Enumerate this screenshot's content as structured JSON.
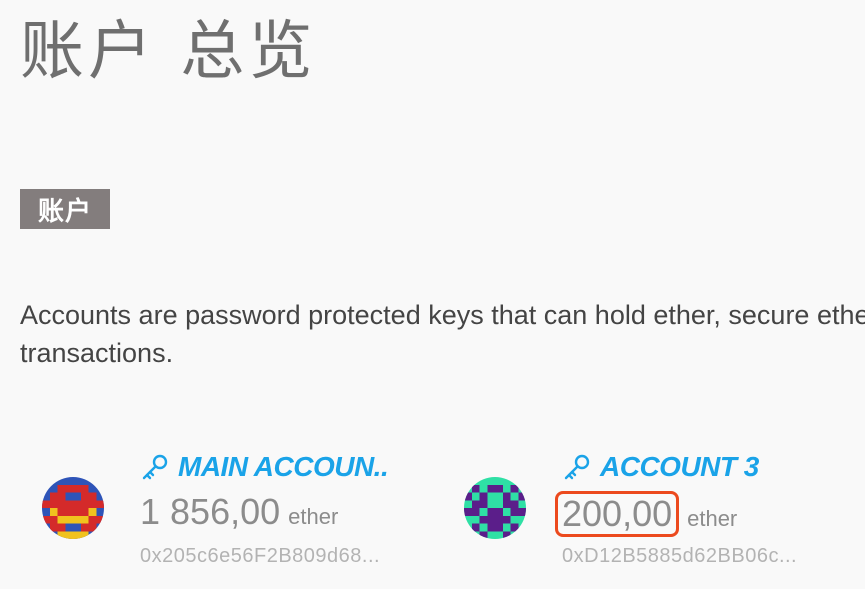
{
  "page": {
    "title": "账户 总览"
  },
  "section": {
    "badge": "账户",
    "description_line1": "Accounts are password protected keys that can hold ether, secure ether",
    "description_line2": "transactions."
  },
  "accounts": [
    {
      "name": "MAIN ACCOUN..",
      "balance": "1 856,00",
      "unit": "ether",
      "address": "0x205c6e56F2B809d68..."
    },
    {
      "name": "ACCOUNT 3",
      "balance": "200,00",
      "unit": "ether",
      "address": "0xD12B5885d62BB06c...",
      "balance_highlighted": true
    }
  ],
  "colors": {
    "accent": "#1aa3e8",
    "badge_bg": "#837d7d",
    "highlight": "#ec4a1e"
  },
  "icons": {
    "key": "key-icon",
    "avatar": "identicon"
  }
}
